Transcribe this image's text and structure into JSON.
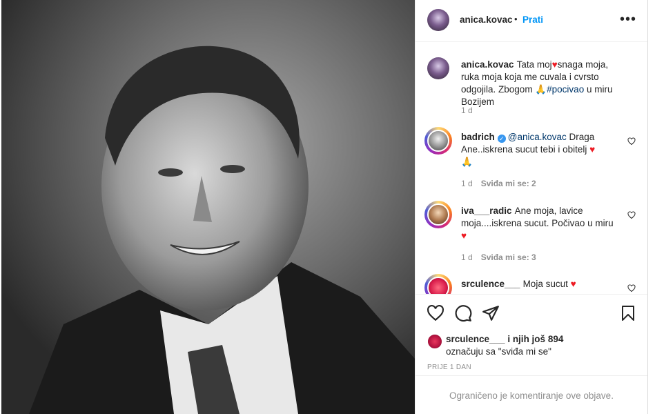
{
  "post": {
    "author": "anica.kovac",
    "follow_label": "Prati",
    "separator": "•",
    "more_label": "•••"
  },
  "caption": {
    "username": "anica.kovac",
    "text_1": "Tata moj",
    "text_2": "snaga moja, ruka moja koja me cuvala i cvrsto odgojila. Zbogom",
    "hashtag": "#pocivao",
    "text_3": " u miru Bozijem",
    "time": "1 d"
  },
  "comments": [
    {
      "username": "badrich",
      "mention": "@anica.kovac",
      "text": "Draga Ane..iskrena sucut tebi i obitelj",
      "time": "1 d",
      "likes": "Sviđa mi se: 2"
    },
    {
      "username": "iva___radic",
      "text": "Ane moja, lavice moja....iskrena sucut. Počivao u miru",
      "time": "1 d",
      "likes": "Sviđa mi se: 3"
    },
    {
      "username": "srculence___",
      "text": "Moja sucut"
    }
  ],
  "likes_summary": {
    "username": "srculence___",
    "and_text": " i njih još 894",
    "line2": "označuju sa \"sviđa mi se\""
  },
  "time_ago": "PRIJE 1 DAN",
  "footer_text": "Ograničeno je komentiranje ove objave.",
  "icons": {
    "like": "heart-icon",
    "comment": "comment-icon",
    "share": "paper-plane-icon",
    "save": "bookmark-icon"
  },
  "colors": {
    "link": "#0095f6",
    "mention": "#00376b",
    "muted": "#8e8e8e",
    "heart": "#ed1c24"
  }
}
